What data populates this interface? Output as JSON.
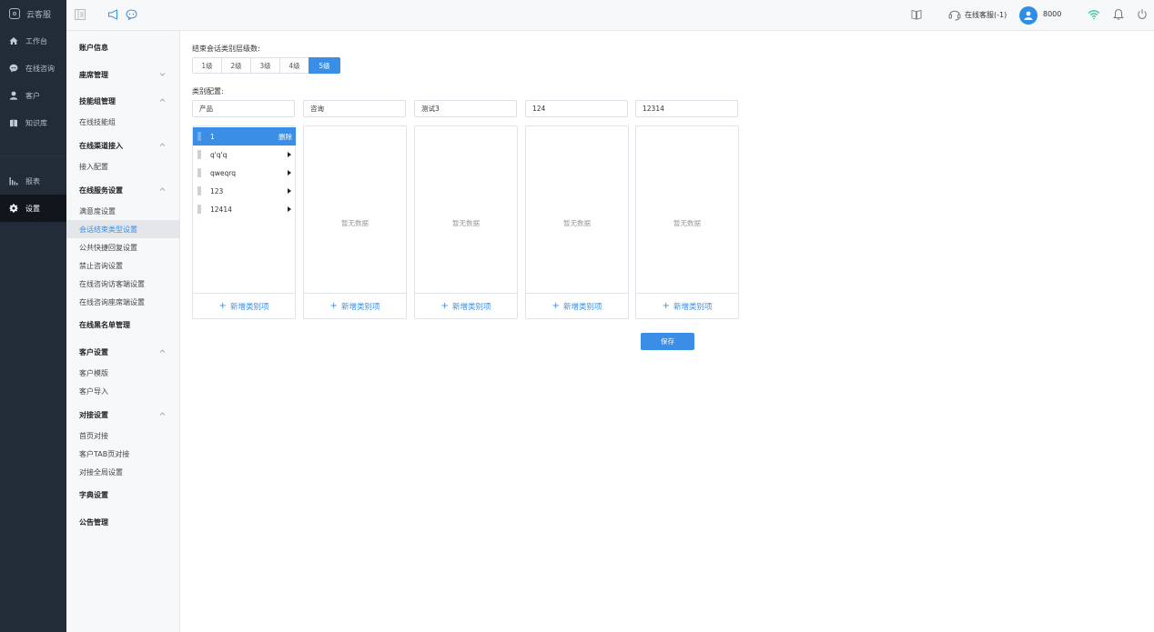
{
  "app": {
    "name": "云客服"
  },
  "rail": {
    "items": [
      {
        "label": "工作台",
        "icon": "home-icon"
      },
      {
        "label": "在线咨询",
        "icon": "chat-icon"
      },
      {
        "label": "客户",
        "icon": "user-icon"
      },
      {
        "label": "知识库",
        "icon": "book-icon"
      },
      {
        "label": "报表",
        "icon": "bar-chart-icon"
      },
      {
        "label": "设置",
        "icon": "gear-icon",
        "active": true
      }
    ]
  },
  "topbar": {
    "agent_status": "在线客服(-1)",
    "agent_id": "8000"
  },
  "submenu": {
    "groups": [
      {
        "label": "账户信息"
      },
      {
        "label": "座席管理"
      },
      {
        "label": "技能组管理",
        "items": [
          "在线技能组"
        ]
      },
      {
        "label": "在线渠道接入",
        "items": [
          "接入配置"
        ]
      },
      {
        "label": "在线服务设置",
        "items": [
          "满意度设置",
          "会话结束类型设置",
          "公共快捷回复设置",
          "禁止咨询设置",
          "在线咨询访客端设置",
          "在线咨询座席端设置"
        ]
      },
      {
        "label": "在线黑名单管理"
      },
      {
        "label": "客户设置",
        "items": [
          "客户模版",
          "客户导入"
        ]
      },
      {
        "label": "对接设置",
        "items": [
          "首页对接",
          "客户TAB页对接",
          "对接全局设置"
        ]
      },
      {
        "label": "字典设置"
      },
      {
        "label": "公告管理"
      }
    ],
    "active_item": "会话结束类型设置"
  },
  "main": {
    "levels_label": "结束会话类别层级数:",
    "levels": [
      "1级",
      "2级",
      "3级",
      "4级",
      "5级"
    ],
    "selected_level": "5级",
    "category_label": "类别配置:",
    "columns": [
      {
        "name": "产品",
        "items": [
          "1",
          "q'q'q",
          "qweqrq",
          "123",
          "12414"
        ],
        "selected": "1",
        "delete_label": "删除"
      },
      {
        "name": "咨询",
        "items": [],
        "empty": "暂无数据"
      },
      {
        "name": "测试3",
        "items": [],
        "empty": "暂无数据"
      },
      {
        "name": "124",
        "items": [],
        "empty": "暂无数据"
      },
      {
        "name": "12314",
        "items": [],
        "empty": "暂无数据"
      }
    ],
    "add_label": "新增类别项",
    "save_label": "保存"
  },
  "colors": {
    "accent": "#3a8ee6",
    "rail_bg": "#222b38",
    "rail_active": "#11161d"
  }
}
